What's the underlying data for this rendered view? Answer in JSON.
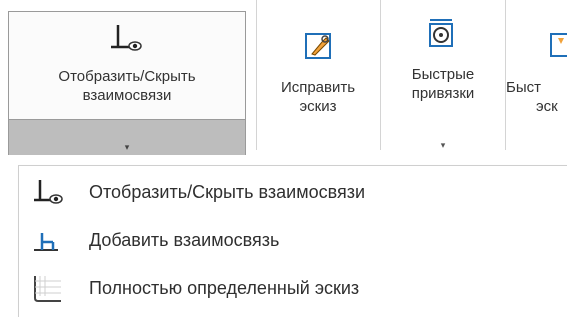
{
  "ribbon": {
    "show_hide_relations": {
      "line1": "Отобразить/Скрыть",
      "line2": "взаимосвязи",
      "dropdown": "▾"
    },
    "repair_sketch": {
      "line1": "Исправить",
      "line2": "эскиз"
    },
    "quick_snaps": {
      "line1": "Быстрые",
      "line2": "привязки",
      "dropdown": "▾"
    },
    "partial_next": {
      "line1": "Быст",
      "line2": "эск"
    }
  },
  "menu": {
    "items": [
      {
        "label": "Отобразить/Скрыть взаимосвязи",
        "icon": "show-relations-icon"
      },
      {
        "label": "Добавить взаимосвязь",
        "icon": "add-relation-icon"
      },
      {
        "label": "Полностью определенный эскиз",
        "icon": "fully-defined-sketch-icon"
      }
    ]
  },
  "colors": {
    "accent_blue": "#1f6fb8",
    "split_bar": "#bdbdbd",
    "border": "#9a9a9a"
  }
}
